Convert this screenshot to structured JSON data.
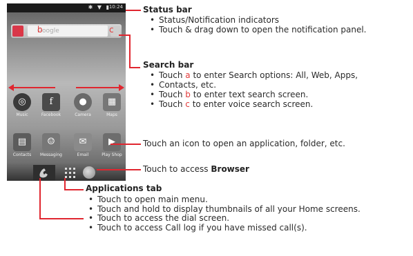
{
  "phone": {
    "status_time": "10:24",
    "search_letter_a": "a",
    "search_letter_b": "b",
    "search_letter_c": "c",
    "apps_row1": [
      {
        "label": "Music"
      },
      {
        "label": "Facebook"
      },
      {
        "label": "Camera"
      },
      {
        "label": "Maps"
      }
    ],
    "apps_row2": [
      {
        "label": "Contacts"
      },
      {
        "label": "Messaging"
      },
      {
        "label": "Email"
      },
      {
        "label": "Play Shop"
      }
    ]
  },
  "callouts": {
    "status_bar": {
      "title": "Status bar",
      "bullets": [
        "Status/Notification indicators",
        "Touch & drag down to open the notification panel."
      ]
    },
    "search_bar": {
      "title": "Search bar",
      "b1_pre": "Touch ",
      "b1_letter": "a",
      "b1_post": " to enter Search options: All, Web, Apps,",
      "b1_cont": "Contacts, etc.",
      "b2_pre": "Touch ",
      "b2_letter": "b",
      "b2_post": " to enter text search screen.",
      "b3_pre": "Touch ",
      "b3_letter": "c",
      "b3_post": " to enter voice search screen."
    },
    "icon_text": "Touch an icon to open an application, folder, etc.",
    "browser_pre": "Touch to access ",
    "browser_word": "Browser",
    "apps_tab": {
      "title": "Applications tab",
      "bullets": [
        "Touch to open main menu.",
        "Touch and hold to display thumbnails of all your Home screens."
      ]
    },
    "dial": {
      "bullets": [
        "Touch to access the dial screen.",
        "Touch to access Call log if you have missed call(s)."
      ]
    }
  }
}
